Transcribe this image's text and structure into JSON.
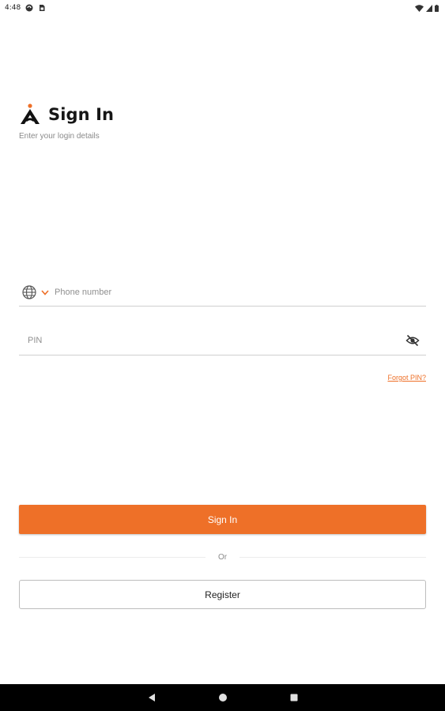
{
  "status_bar": {
    "time": "4:48",
    "left_icons": [
      "sync-icon",
      "sim-card-icon"
    ],
    "right_icons": [
      "wifi-icon",
      "signal-icon",
      "battery-icon"
    ]
  },
  "header": {
    "logo_icon": "brand-logo-icon",
    "title": "Sign In",
    "subtitle": "Enter your login details"
  },
  "form": {
    "phone": {
      "country_icon": "globe-icon",
      "dropdown_icon": "chevron-down-icon",
      "placeholder": "Phone number",
      "value": ""
    },
    "pin": {
      "placeholder": "PIN",
      "value": "",
      "toggle_icon": "eye-off-icon"
    },
    "forgot_label": "Forgot PIN?"
  },
  "actions": {
    "signin_label": "Sign In",
    "divider_label": "Or",
    "register_label": "Register"
  },
  "colors": {
    "accent": "#ee7028",
    "nav_bar": "#000000"
  },
  "nav_bar": {
    "buttons": [
      "back-icon",
      "home-icon",
      "recents-icon"
    ]
  }
}
